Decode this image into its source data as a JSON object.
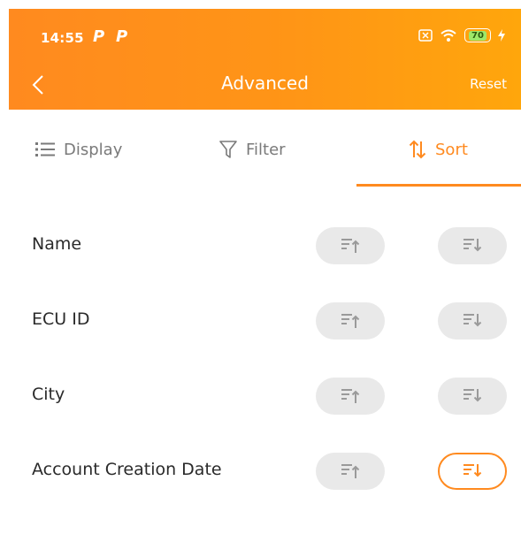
{
  "status_bar": {
    "time": "14:55",
    "notif_1": "P",
    "notif_2": "P",
    "battery": "70"
  },
  "header": {
    "title": "Advanced",
    "reset_label": "Reset"
  },
  "tabs": [
    {
      "label": "Display",
      "icon": "list-icon"
    },
    {
      "label": "Filter",
      "icon": "funnel-icon"
    },
    {
      "label": "Sort",
      "icon": "sort-arrows-icon"
    }
  ],
  "selected_tab": "Sort",
  "sort_options": [
    {
      "label": "Name",
      "selected": null
    },
    {
      "label": "ECU ID",
      "selected": null
    },
    {
      "label": "City",
      "selected": null
    },
    {
      "label": "Account Creation Date",
      "selected": "descending"
    }
  ],
  "colors": {
    "accent": "#ff8a1f",
    "inactive_button": "#e9e9e9",
    "inactive_icon": "#9a9a9a"
  }
}
